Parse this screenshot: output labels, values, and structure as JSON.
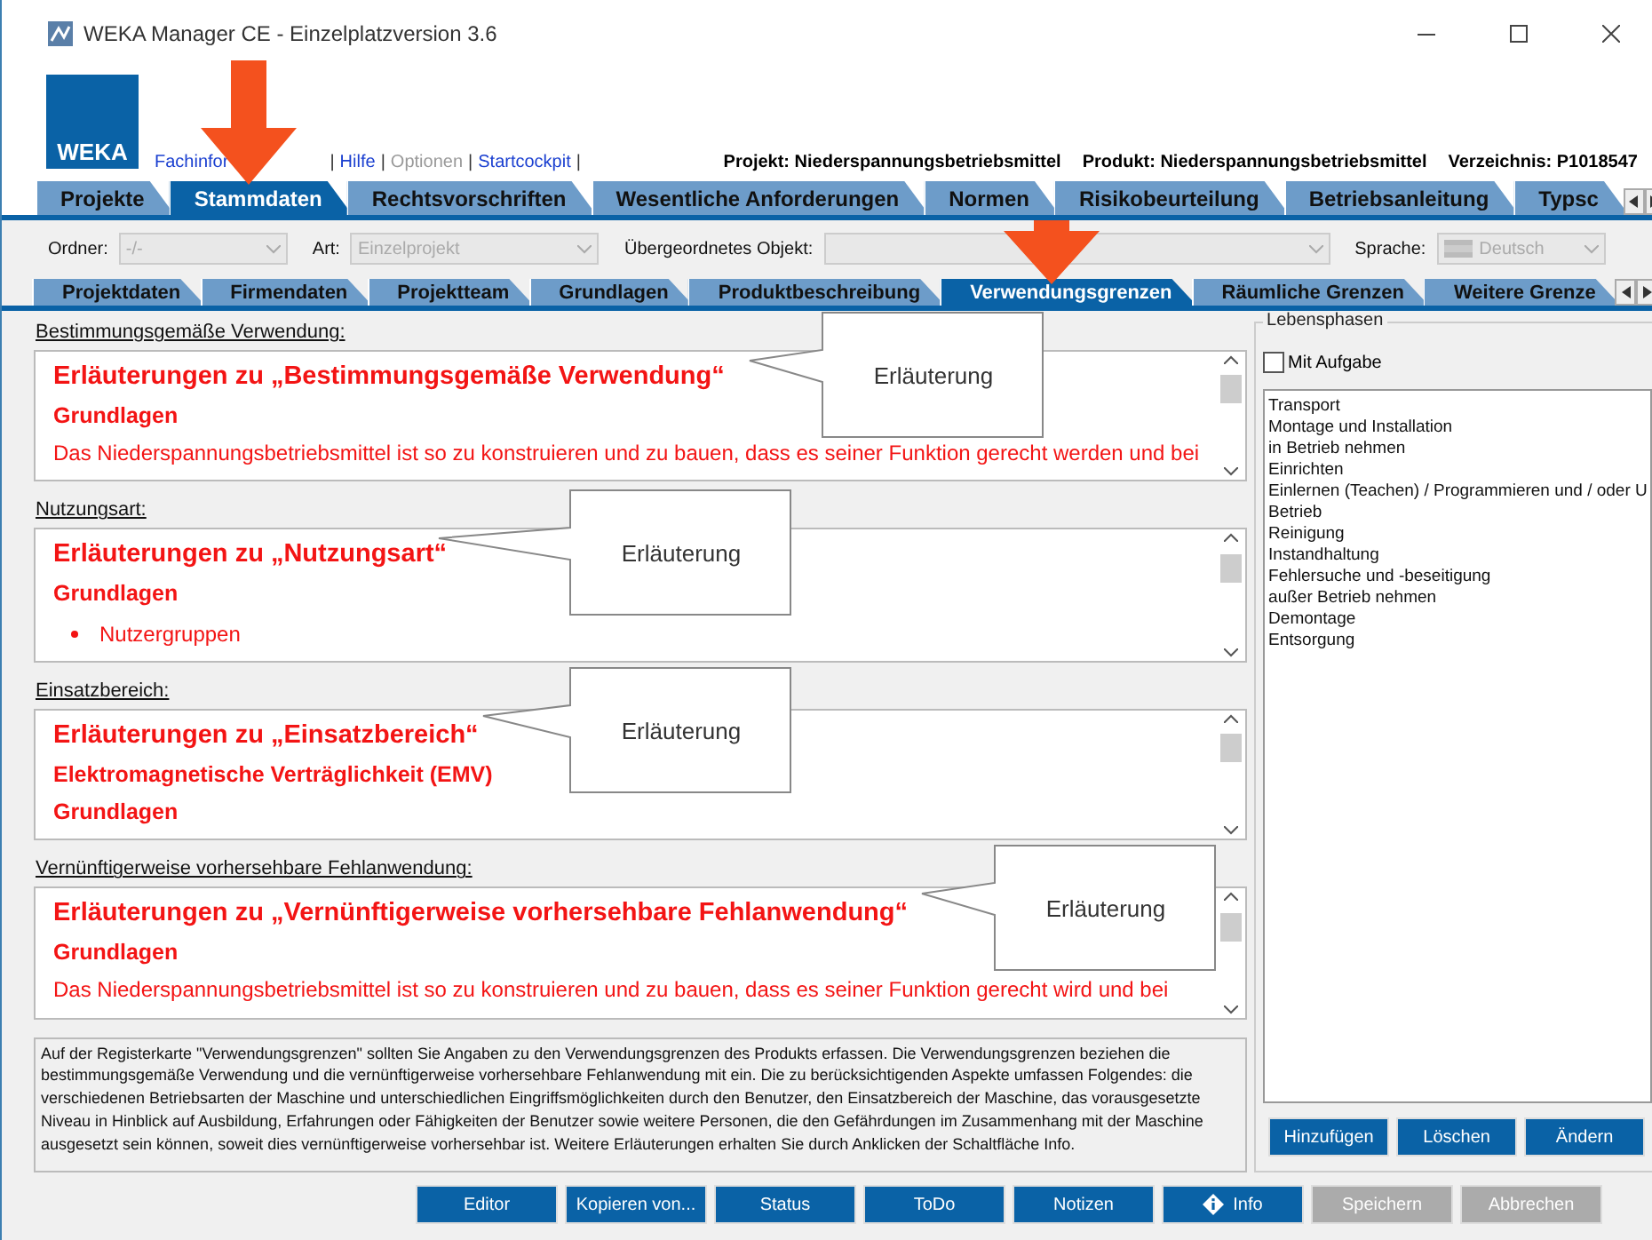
{
  "window": {
    "title": "WEKA Manager CE - Einzelplatzversion 3.6"
  },
  "logo": {
    "text": "WEKA"
  },
  "links": [
    {
      "label": "Fachinfor",
      "disabled": false
    },
    {
      "label": "Hilfe",
      "disabled": false
    },
    {
      "label": "Optionen",
      "disabled": true
    },
    {
      "label": "Startcockpit",
      "disabled": false
    }
  ],
  "link_separator": "|",
  "project_info": [
    "Projekt: Niederspannungsbetriebsmittel",
    "Produkt: Niederspannungsbetriebsmittel",
    "Verzeichnis: P1018547"
  ],
  "main_tabs": [
    {
      "label": "Projekte",
      "selected": false
    },
    {
      "label": "Stammdaten",
      "selected": true
    },
    {
      "label": "Rechtsvorschriften",
      "selected": false
    },
    {
      "label": "Wesentliche Anforderungen",
      "selected": false
    },
    {
      "label": "Normen",
      "selected": false
    },
    {
      "label": "Risikobeurteilung",
      "selected": false
    },
    {
      "label": "Betriebsanleitung",
      "selected": false
    },
    {
      "label": "Typsc",
      "selected": false
    }
  ],
  "filters": [
    {
      "label": "Ordner:",
      "value": "-/-",
      "kind": "small"
    },
    {
      "label": "Art:",
      "value": "Einzelprojekt",
      "kind": "medium"
    },
    {
      "label": "Übergeordnetes Objekt:",
      "kind": "wide"
    },
    {
      "label": "Sprache:",
      "value": "Deutsch",
      "kind": "language"
    }
  ],
  "sub_tabs": [
    {
      "label": "Projektdaten",
      "selected": false
    },
    {
      "label": "Firmendaten",
      "selected": false
    },
    {
      "label": "Projektteam",
      "selected": false
    },
    {
      "label": "Grundlagen",
      "selected": false
    },
    {
      "label": "Produktbeschreibung",
      "selected": false
    },
    {
      "label": "Verwendungsgrenzen",
      "selected": true
    },
    {
      "label": "Räumliche Grenzen",
      "selected": false
    },
    {
      "label": "Weitere Grenze",
      "selected": false
    }
  ],
  "sections": [
    {
      "label": "Bestimmungsgemäße Verwendung:",
      "callout": "Erläuterung",
      "lines": [
        {
          "kind": "heading",
          "text": "Erläuterungen zu „Bestimmungsgemäße Verwendung“"
        },
        {
          "kind": "subheading",
          "text": "Grundlagen"
        },
        {
          "kind": "text",
          "text": "Das Niederspannungsbetriebsmittel ist so zu konstruieren und zu bauen, dass es seiner Funktion gerecht werden und bei"
        }
      ]
    },
    {
      "label": "Nutzungsart:",
      "callout": "Erläuterung",
      "lines": [
        {
          "kind": "heading",
          "text": "Erläuterungen zu „Nutzungsart“"
        },
        {
          "kind": "subheading",
          "text": "Grundlagen"
        },
        {
          "kind": "bullet",
          "text": "Nutzergruppen"
        }
      ]
    },
    {
      "label": "Einsatzbereich:",
      "callout": "Erläuterung",
      "lines": [
        {
          "kind": "heading",
          "text": "Erläuterungen zu „Einsatzbereich“"
        },
        {
          "kind": "subheading",
          "text": "Elektromagnetische Verträglichkeit (EMV)"
        },
        {
          "kind": "subheading",
          "text": "Grundlagen"
        }
      ]
    },
    {
      "label": "Vernünftigerweise vorhersehbare Fehlanwendung:",
      "callout": "Erläuterung",
      "lines": [
        {
          "kind": "heading",
          "text": "Erläuterungen zu „Vernünftigerweise vorhersehbare Fehlanwendung“"
        },
        {
          "kind": "subheading",
          "text": "Grundlagen"
        },
        {
          "kind": "text",
          "text": "Das Niederspannungsbetriebsmittel ist so zu konstruieren und zu bauen, dass es seiner Funktion gerecht wird und bei"
        }
      ]
    }
  ],
  "lifecycle": {
    "title": "Lebensphasen",
    "checkbox": {
      "label": "Mit Aufgabe",
      "checked": false
    },
    "items": [
      "Transport",
      "Montage und Installation",
      "in Betrieb nehmen",
      "Einrichten",
      "Einlernen (Teachen) / Programmieren und / oder U",
      "Betrieb",
      "Reinigung",
      "Instandhaltung",
      "Fehlersuche und -beseitigung",
      "außer Betrieb nehmen",
      "Demontage",
      "Entsorgung"
    ],
    "buttons": [
      "Hinzufügen",
      "Löschen",
      "Ändern"
    ]
  },
  "info_text": "Auf der Registerkarte \"Verwendungsgrenzen\" sollten Sie Angaben zu den Verwendungsgrenzen des Produkts erfassen. Die Verwendungsgrenzen beziehen die bestimmungsgemäße Verwendung und die vernünftigerweise vorhersehbare Fehlanwendung mit ein. Die zu berücksichtigenden Aspekte umfassen Folgendes: die verschiedenen Betriebsarten der Maschine und unterschiedlichen Eingriffsmöglichkeiten durch den Benutzer, den Einsatzbereich der Maschine, das vorausgesetzte Niveau in Hinblick auf Ausbildung, Erfahrungen oder Fähigkeiten der Benutzer sowie weitere Personen, die den Gefährdungen im Zusammenhang mit der Maschine ausgesetzt sein können, soweit dies vernünftigerweise vorhersehbar ist. Weitere Erläuterungen erhalten Sie durch Anklicken der Schaltfläche Info.",
  "buttons": [
    {
      "label": "Editor",
      "disabled": false,
      "kind": "plain"
    },
    {
      "label": "Kopieren von...",
      "disabled": false,
      "kind": "plain"
    },
    {
      "label": "Status",
      "disabled": false,
      "kind": "plain"
    },
    {
      "label": "ToDo",
      "disabled": false,
      "kind": "plain"
    },
    {
      "label": "Notizen",
      "disabled": false,
      "kind": "plain"
    },
    {
      "label": "Info",
      "disabled": false,
      "kind": "info"
    },
    {
      "label": "Speichern",
      "disabled": true,
      "kind": "plain"
    },
    {
      "label": "Abbrechen",
      "disabled": true,
      "kind": "plain"
    }
  ]
}
